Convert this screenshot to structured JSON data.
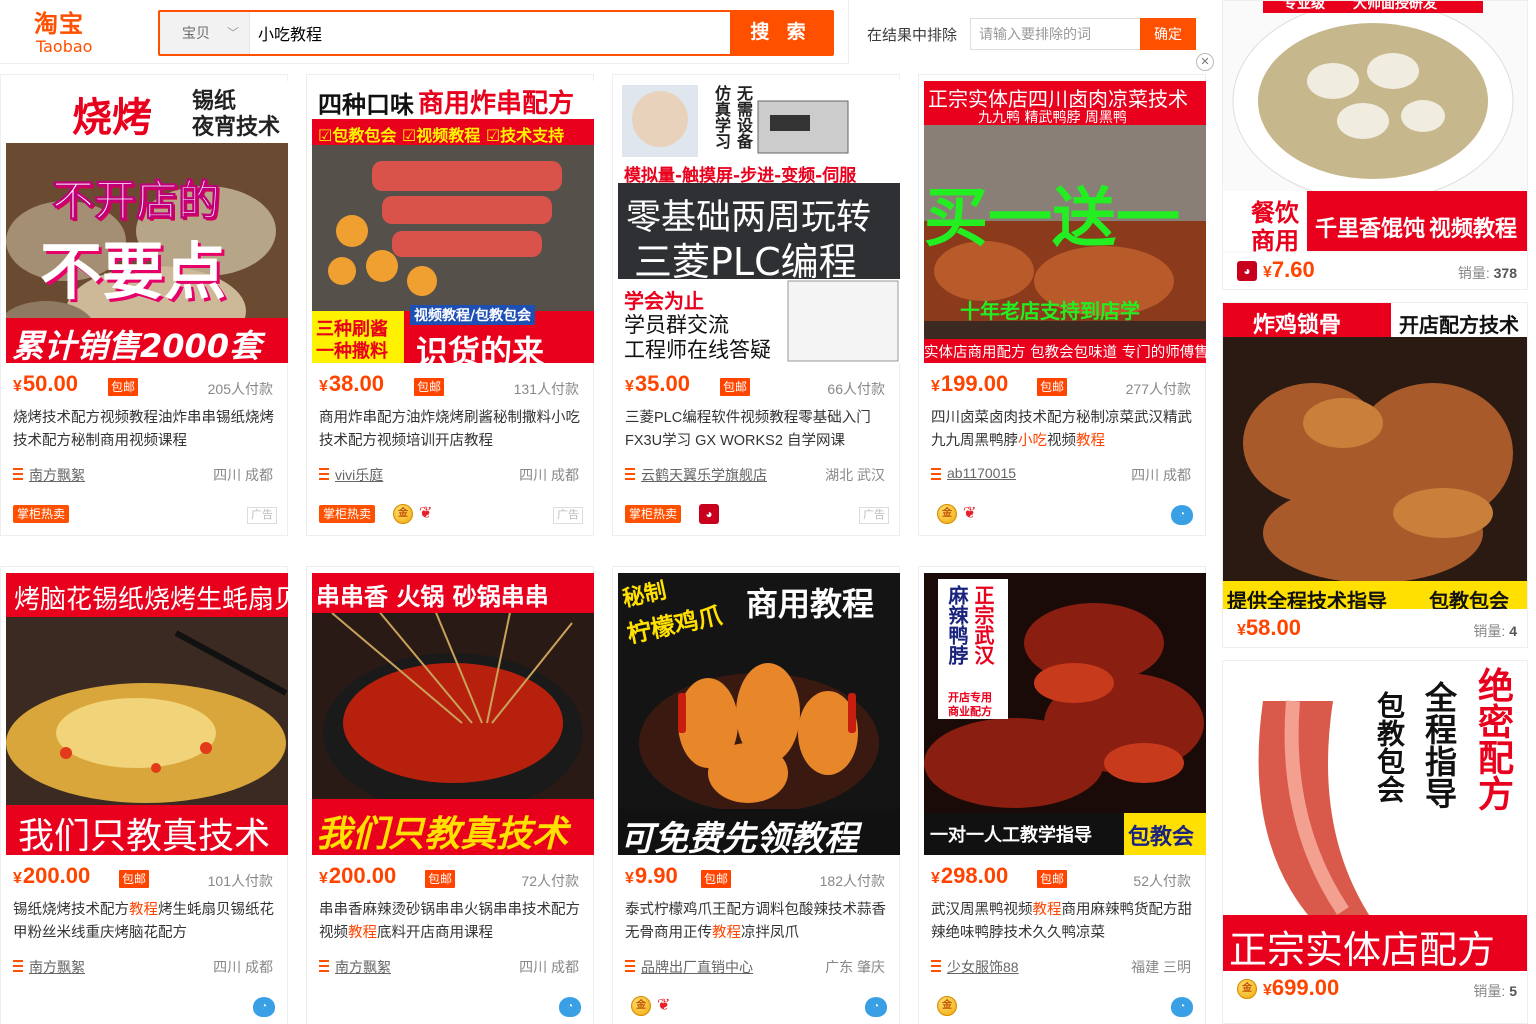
{
  "header": {
    "logo_cn": "淘宝",
    "logo_en": "Taobao",
    "search_category": "宝贝",
    "search_query": "小吃教程",
    "search_button": "搜 索",
    "exclude_label": "在结果中排除",
    "exclude_placeholder": "请输入要排除的词",
    "exclude_button": "确定"
  },
  "products": [
    {
      "image_lines": [
        "烧烤",
        "锡纸",
        "夜宵技术",
        "不开店的",
        "不要点",
        "累计销售2000套"
      ],
      "price": "50.00",
      "free_ship": "包邮",
      "deals": "205人付款",
      "title": "烧烤技术配方视频教程油炸串串锡纸烧烤技术配方秘制商用视频课程",
      "shop": "南方飘絮",
      "location": "四川 成都",
      "badge": "掌柜热卖",
      "ad": "广告"
    },
    {
      "image_lines": [
        "四种口味",
        "商用炸串配方",
        "☑包教包会 ☑视频教程 ☑技术支持",
        "三种刷酱",
        "一种撒料",
        "视频教程/包教包会",
        "识货的来"
      ],
      "price": "38.00",
      "free_ship": "包邮",
      "deals": "131人付款",
      "title": "商用炸串配方油炸烧烤刷酱秘制撒料小吃技术配方视频培训开店教程",
      "shop": "vivi乐庭",
      "location": "四川 成都",
      "badge": "掌柜热卖",
      "ad": "广告"
    },
    {
      "image_lines": [
        "仿真学习",
        "无需设备",
        "模拟量-触摸屏-步进-变频-伺服",
        "零基础两周玩转",
        "三菱PLC编程",
        "学会为止",
        "学员群交流",
        "工程师在线答疑"
      ],
      "price": "35.00",
      "free_ship": "包邮",
      "deals": "66人付款",
      "title": "三菱PLC编程软件视频教程零基础入门FX3U学习 GX WORKS2 自学网课",
      "shop": "云鹤天翼乐学旗舰店",
      "location": "湖北 武汉",
      "badge": "掌柜热卖",
      "ad": "广告"
    },
    {
      "image_lines": [
        "正宗实体店四川卤肉凉菜技术",
        "九九鸭 精武鸭脖 周黑鸭",
        "买一送一",
        "十年老店支持到店学",
        "实体店商用配方 包教会包味道 专门的师傅售后指导"
      ],
      "price": "199.00",
      "free_ship": "包邮",
      "deals": "277人付款",
      "title_a": "四川卤菜卤肉技术配方秘制凉菜武汉精武九九周黑鸭脖",
      "title_hl1": "小吃",
      "title_b": "视频",
      "title_hl2": "教程",
      "shop": "ab1170015",
      "location": "四川 成都"
    },
    {
      "image_lines": [
        "烤脑花锡纸烧烤生蚝扇贝",
        "我们只教真技术"
      ],
      "price": "200.00",
      "free_ship": "包邮",
      "deals": "101人付款",
      "title_a": "锡纸烧烤技术配方",
      "title_hl": "教程",
      "title_b": "烤生蚝扇贝锡纸花甲粉丝米线重庆烤脑花配方",
      "shop": "南方飘絮",
      "location": "四川 成都"
    },
    {
      "image_lines": [
        "串串香  火锅  砂锅串串",
        "我们只教真技术"
      ],
      "price": "200.00",
      "free_ship": "包邮",
      "deals": "72人付款",
      "title_a": "串串香麻辣烫砂锅串串火锅串串技术配方视频",
      "title_hl": "教程",
      "title_b": "底料开店商用课程",
      "shop": "南方飘絮",
      "location": "四川 成都"
    },
    {
      "image_lines": [
        "秘制",
        "柠檬鸡爪",
        "商用教程",
        "可免费先领教程"
      ],
      "price": "9.90",
      "free_ship": "包邮",
      "deals": "182人付款",
      "title_a": "泰式柠檬鸡爪王配方调料包酸辣技术蒜香无骨商用正传",
      "title_hl": "教程",
      "title_b": "凉拌凤爪",
      "shop": "品牌出厂直销中心",
      "location": "广东 肇庆"
    },
    {
      "image_lines": [
        "正宗武汉",
        "麻辣鸭脖",
        "开店专用",
        "商业配方",
        "一对一人工教学指导",
        "包教会"
      ],
      "price": "298.00",
      "free_ship": "包邮",
      "deals": "52人付款",
      "title_a": "武汉周黑鸭视频",
      "title_hl": "教程",
      "title_b": "商用麻辣鸭货配方甜辣绝味鸭脖技术久久鸭凉菜",
      "shop": "少女服饰88",
      "location": "福建 三明"
    }
  ],
  "side": [
    {
      "image_lines": [
        "专业级",
        "大师面授研发",
        "餐饮",
        "商用",
        "千里香馄饨",
        "视频教程"
      ],
      "price": "7.60",
      "sales_label": "销量:",
      "sales": "378"
    },
    {
      "image_lines": [
        "炸鸡锁骨",
        "开店配方技术",
        "提供全程技术指导",
        "包教包会"
      ],
      "price": "58.00",
      "sales_label": "销量:",
      "sales": "4"
    },
    {
      "image_lines": [
        "绝密配方",
        "全程指导",
        "包教包会",
        "正宗实体店配方"
      ],
      "price": "699.00",
      "sales_label": "销量:",
      "sales": "5"
    }
  ],
  "currency": "¥",
  "colors": {
    "accent": "#ff5000",
    "price": "#ff4400"
  }
}
